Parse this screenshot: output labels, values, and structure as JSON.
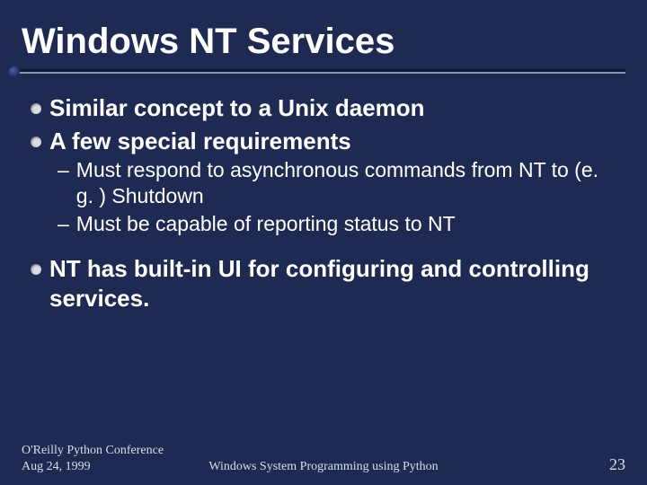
{
  "title": "Windows NT Services",
  "bullets_a": [
    "Similar concept to a Unix daemon",
    "A few special requirements"
  ],
  "subbullets": [
    "Must respond to asynchronous commands from NT to (e. g. ) Shutdown",
    "Must be capable of reporting status to NT"
  ],
  "bullets_b": [
    "NT has built-in UI for configuring and controlling services."
  ],
  "footer": {
    "left_line1": "O'Reilly Python Conference",
    "left_line2": "Aug 24, 1999",
    "center": "Windows System Programming using Python",
    "page": "23"
  }
}
